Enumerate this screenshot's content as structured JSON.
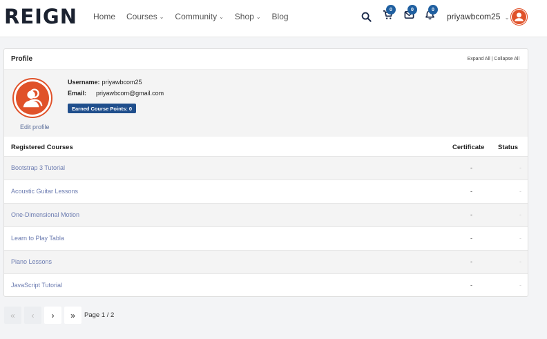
{
  "header": {
    "logo": "REIGN",
    "nav": [
      {
        "label": "Home",
        "has_dropdown": false
      },
      {
        "label": "Courses",
        "has_dropdown": true
      },
      {
        "label": "Community",
        "has_dropdown": true
      },
      {
        "label": "Shop",
        "has_dropdown": true
      },
      {
        "label": "Blog",
        "has_dropdown": false
      }
    ],
    "icons": {
      "search": "search-icon",
      "cart": {
        "icon": "cart-icon",
        "count": "0"
      },
      "messages": {
        "icon": "mail-icon",
        "count": "0"
      },
      "notifications": {
        "icon": "bell-icon",
        "count": "0"
      }
    },
    "username": "priyawbcom25",
    "accent_color": "#1f5fa0",
    "avatar_color": "#e0522a"
  },
  "profile": {
    "title": "Profile",
    "expand_all": "Expand All",
    "separator": "|",
    "collapse_all": "Collapse All",
    "username_label": "Username:",
    "username_value": "priyawbcom25",
    "email_label": "Email:",
    "email_value": "priyawbcom@gmail.com",
    "points_label": "Earned Course Points: 0",
    "edit_profile": "Edit profile"
  },
  "courses": {
    "headers": {
      "title": "Registered Courses",
      "certificate": "Certificate",
      "status": "Status"
    },
    "rows": [
      {
        "title": "Bootstrap 3 Tutorial",
        "certificate": "-",
        "status": "-"
      },
      {
        "title": "Acoustic Guitar Lessons",
        "certificate": "-",
        "status": "-"
      },
      {
        "title": "One-Dimensional Motion",
        "certificate": "-",
        "status": "-"
      },
      {
        "title": "Learn to Play Tabla",
        "certificate": "-",
        "status": "-"
      },
      {
        "title": "Piano Lessons",
        "certificate": "-",
        "status": "-"
      },
      {
        "title": "JavaScript Tutorial",
        "certificate": "-",
        "status": "-"
      }
    ]
  },
  "pagination": {
    "first": "«",
    "prev": "‹",
    "next": "›",
    "last": "»",
    "label": "Page 1 / 2"
  }
}
